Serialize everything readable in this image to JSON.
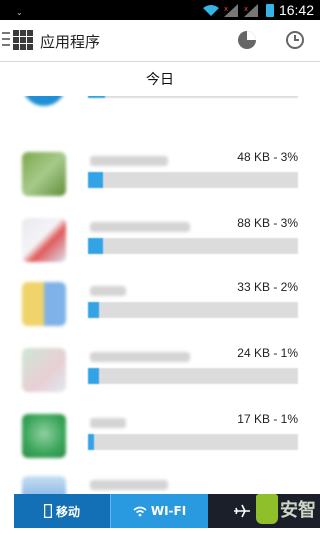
{
  "statusbar": {
    "time": "16:42"
  },
  "header": {
    "title": "应用程序"
  },
  "section": {
    "title": "今日"
  },
  "apps": [
    {
      "size": "",
      "fill_fraction": 0.08,
      "icon_colors": [
        "#1f8fd6",
        "#ffffff"
      ]
    },
    {
      "size": "48 KB - 3%",
      "fill_fraction": 0.07,
      "icon_colors": [
        "#7aa84a",
        "#a7c98a"
      ]
    },
    {
      "size": "88 KB - 3%",
      "fill_fraction": 0.07,
      "icon_colors": [
        "#e8e8ee",
        "#e05a5a"
      ]
    },
    {
      "size": "33 KB - 2%",
      "fill_fraction": 0.05,
      "icon_colors": [
        "#f0d36a",
        "#7fb2e8"
      ]
    },
    {
      "size": "24 KB - 1%",
      "fill_fraction": 0.05,
      "icon_colors": [
        "#cfe6d4",
        "#e8cfd4"
      ]
    },
    {
      "size": "17 KB - 1%",
      "fill_fraction": 0.03,
      "icon_colors": [
        "#3aa55a",
        "#8fd0a0"
      ]
    },
    {
      "size": "",
      "fill_fraction": 0.03,
      "icon_colors": [
        "#4a90d9",
        "#c8dff3"
      ]
    }
  ],
  "bottom_tabs": {
    "mobile": "移动",
    "wifi": "WI-FI",
    "airplane": ""
  },
  "watermark": {
    "text": "安智"
  }
}
